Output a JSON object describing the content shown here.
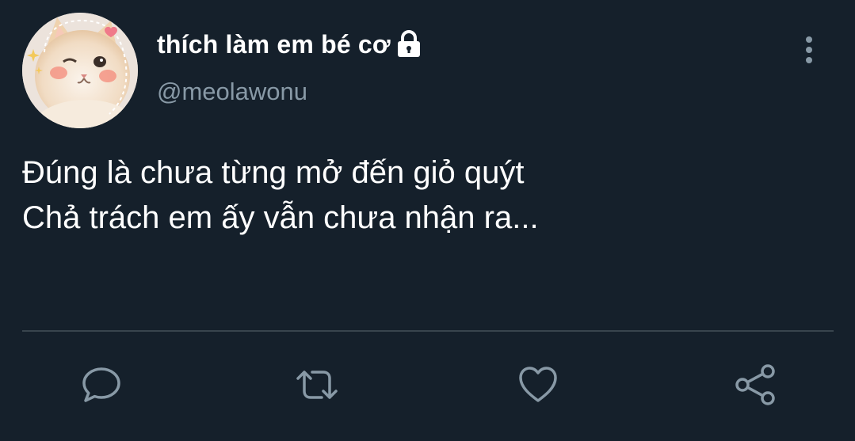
{
  "tweet": {
    "display_name": "thích làm em bé cơ",
    "handle": "@meolawonu",
    "text_lines": [
      "Đúng là chưa từng mở đến giỏ quýt",
      "Chả trách em ấy vẫn chưa nhận ra..."
    ],
    "protected": true
  },
  "icons": {
    "avatar": "cat-avatar",
    "lock": "lock-icon",
    "more": "more-vertical-icon",
    "reply": "reply-icon",
    "retweet": "retweet-icon",
    "like": "heart-icon",
    "share": "share-icon"
  },
  "colors": {
    "background": "#15202b",
    "text_primary": "#ffffff",
    "text_secondary": "#8899a6",
    "divider": "#38444d",
    "icon": "#8899a6"
  }
}
